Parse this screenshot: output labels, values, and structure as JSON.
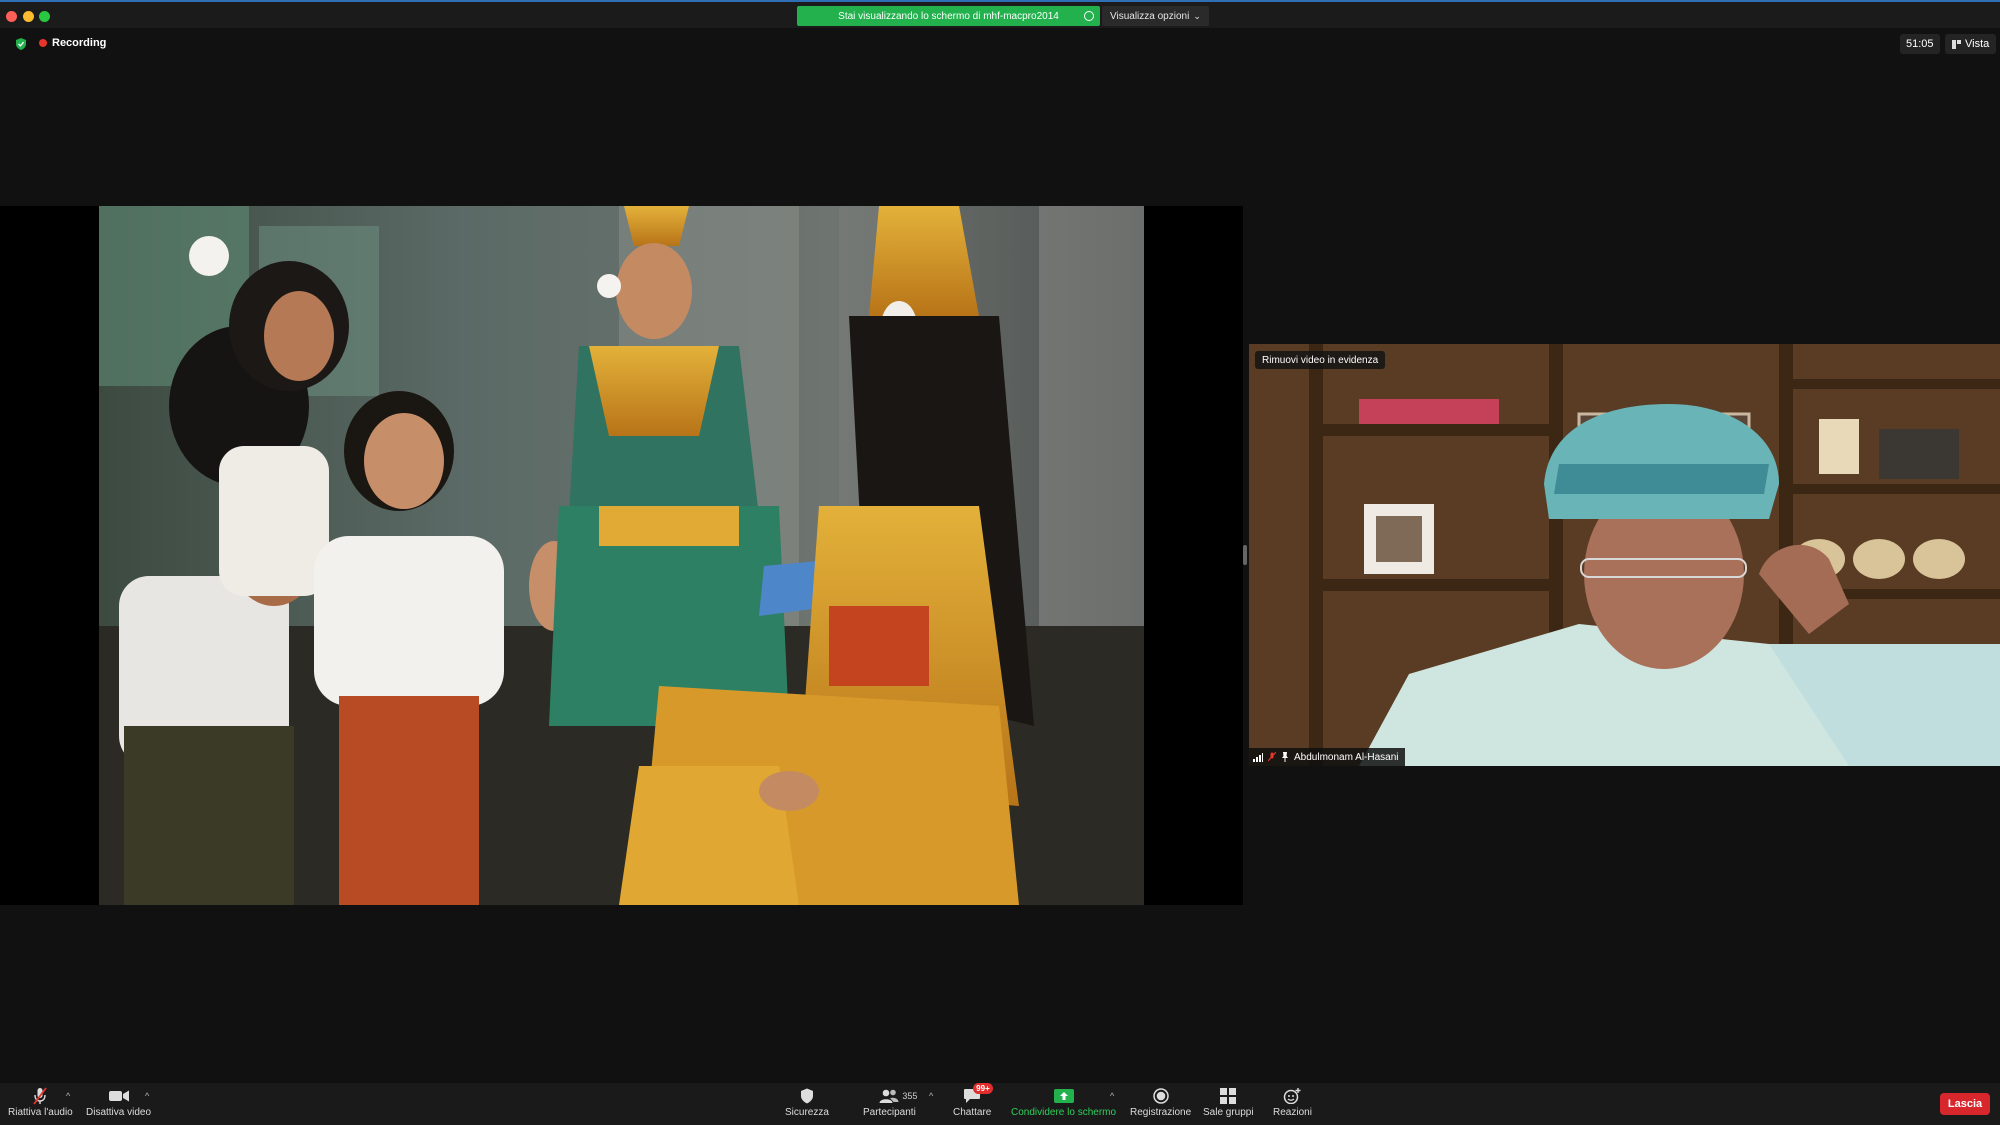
{
  "titlebar": {
    "share_banner": "Stai visualizzando lo schermo di mhf-macpro2014",
    "view_options": "Visualizza opzioni"
  },
  "status": {
    "recording": "Recording",
    "timer": "51:05",
    "view": "Vista"
  },
  "video_tile": {
    "remove_spotlight": "Rimuovi video in evidenza",
    "participant_name": "Abdulmonam Al-Hasani"
  },
  "toolbar": {
    "unmute": "Riattiva l'audio",
    "stop_video": "Disattiva video",
    "security": "Sicurezza",
    "participants": "Partecipanti",
    "participants_count": "355",
    "chat": "Chattare",
    "chat_badge": "99+",
    "share_screen": "Condividere lo schermo",
    "record": "Registrazione",
    "breakout": "Sale gruppi",
    "reactions": "Reazioni",
    "leave": "Lascia"
  },
  "colors": {
    "share_green": "#22b14c",
    "recording_red": "#e8352b",
    "leave_red": "#d8262d",
    "background": "#111111"
  }
}
